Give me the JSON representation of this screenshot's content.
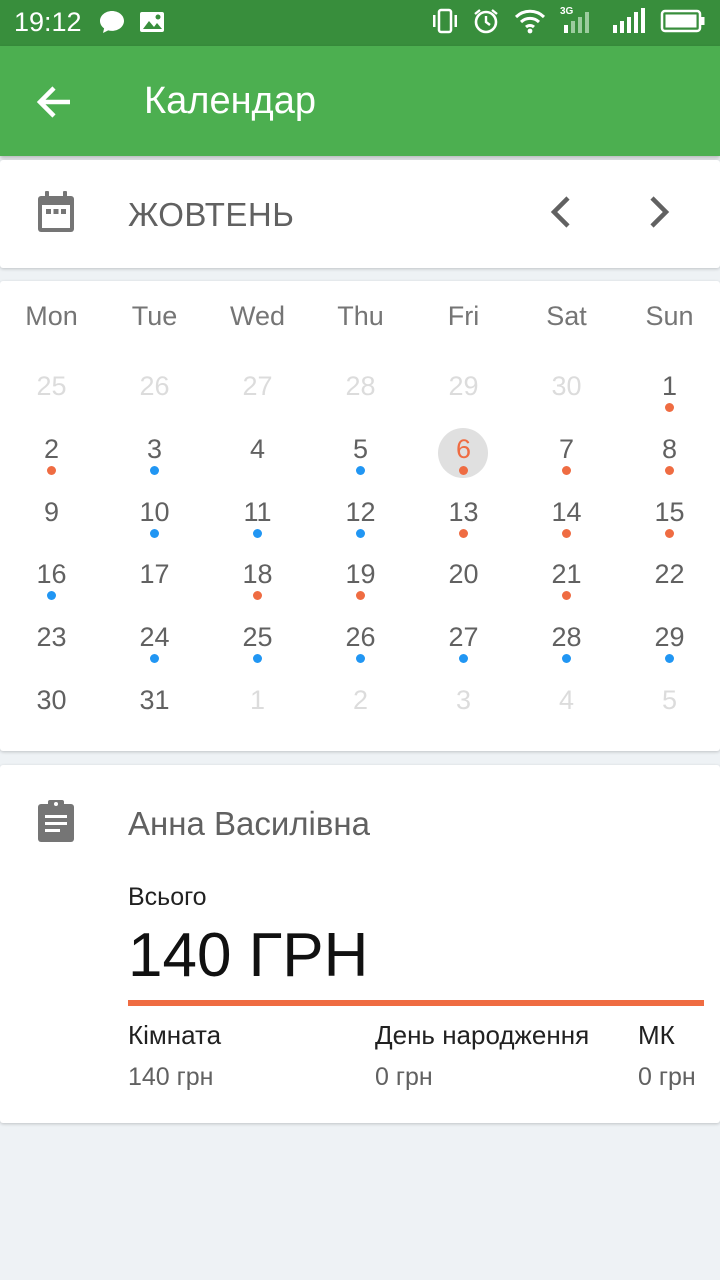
{
  "status_bar": {
    "time": "19:12",
    "left_icons": [
      "chat-bubble-icon",
      "image-icon"
    ],
    "right_icons": [
      "vibrate-icon",
      "alarm-icon",
      "wifi-icon",
      "signal-3g-icon",
      "signal-icon",
      "battery-icon"
    ],
    "network_label": "3G"
  },
  "app_bar": {
    "title": "Календар",
    "back_icon": "arrow-left-icon"
  },
  "month_header": {
    "month": "ЖОВТЕНЬ",
    "calendar_icon": "calendar-icon",
    "prev_icon": "chevron-left-icon",
    "next_icon": "chevron-right-icon"
  },
  "calendar": {
    "weekdays": [
      "Mon",
      "Tue",
      "Wed",
      "Thu",
      "Fri",
      "Sat",
      "Sun"
    ],
    "today": "6",
    "dot_colors": {
      "orange": "#ef6c42",
      "blue": "#2196f3"
    },
    "weeks": [
      [
        {
          "day": "25",
          "other": true,
          "dot": null
        },
        {
          "day": "26",
          "other": true,
          "dot": null
        },
        {
          "day": "27",
          "other": true,
          "dot": null
        },
        {
          "day": "28",
          "other": true,
          "dot": null
        },
        {
          "day": "29",
          "other": true,
          "dot": null
        },
        {
          "day": "30",
          "other": true,
          "dot": null
        },
        {
          "day": "1",
          "other": false,
          "dot": "orange"
        }
      ],
      [
        {
          "day": "2",
          "other": false,
          "dot": "orange"
        },
        {
          "day": "3",
          "other": false,
          "dot": "blue"
        },
        {
          "day": "4",
          "other": false,
          "dot": null
        },
        {
          "day": "5",
          "other": false,
          "dot": "blue"
        },
        {
          "day": "6",
          "other": false,
          "dot": "orange",
          "today": true
        },
        {
          "day": "7",
          "other": false,
          "dot": "orange"
        },
        {
          "day": "8",
          "other": false,
          "dot": "orange"
        }
      ],
      [
        {
          "day": "9",
          "other": false,
          "dot": null
        },
        {
          "day": "10",
          "other": false,
          "dot": "blue"
        },
        {
          "day": "11",
          "other": false,
          "dot": "blue"
        },
        {
          "day": "12",
          "other": false,
          "dot": "blue"
        },
        {
          "day": "13",
          "other": false,
          "dot": "orange"
        },
        {
          "day": "14",
          "other": false,
          "dot": "orange"
        },
        {
          "day": "15",
          "other": false,
          "dot": "orange"
        }
      ],
      [
        {
          "day": "16",
          "other": false,
          "dot": "blue"
        },
        {
          "day": "17",
          "other": false,
          "dot": null
        },
        {
          "day": "18",
          "other": false,
          "dot": "orange"
        },
        {
          "day": "19",
          "other": false,
          "dot": "orange"
        },
        {
          "day": "20",
          "other": false,
          "dot": null
        },
        {
          "day": "21",
          "other": false,
          "dot": "orange"
        },
        {
          "day": "22",
          "other": false,
          "dot": null
        }
      ],
      [
        {
          "day": "23",
          "other": false,
          "dot": null
        },
        {
          "day": "24",
          "other": false,
          "dot": "blue"
        },
        {
          "day": "25",
          "other": false,
          "dot": "blue"
        },
        {
          "day": "26",
          "other": false,
          "dot": "blue"
        },
        {
          "day": "27",
          "other": false,
          "dot": "blue"
        },
        {
          "day": "28",
          "other": false,
          "dot": "blue"
        },
        {
          "day": "29",
          "other": false,
          "dot": "blue"
        }
      ],
      [
        {
          "day": "30",
          "other": false,
          "dot": null
        },
        {
          "day": "31",
          "other": false,
          "dot": null
        },
        {
          "day": "1",
          "other": true,
          "dot": null
        },
        {
          "day": "2",
          "other": true,
          "dot": null
        },
        {
          "day": "3",
          "other": true,
          "dot": null
        },
        {
          "day": "4",
          "other": true,
          "dot": null
        },
        {
          "day": "5",
          "other": true,
          "dot": null
        }
      ]
    ]
  },
  "summary": {
    "icon": "clipboard-icon",
    "name": "Анна Василівна",
    "total_label": "Всього",
    "total_value": "140 ГРН",
    "accent_color": "#ef6c42",
    "breakdown": [
      {
        "label": "Кімната",
        "value": "140 грн"
      },
      {
        "label": "День народження",
        "value": "0 грн"
      },
      {
        "label": "МК",
        "value": "0 грн"
      }
    ]
  },
  "colors": {
    "status_bar": "#388e3c",
    "app_bar": "#4caf50",
    "background": "#eef2f5"
  }
}
